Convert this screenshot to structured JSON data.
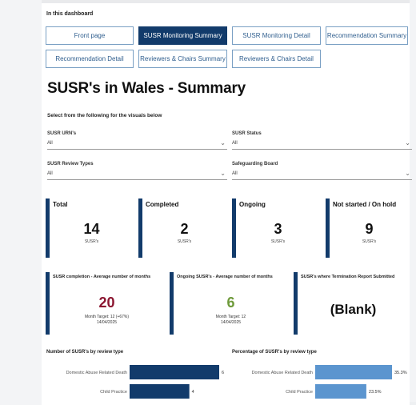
{
  "nav": {
    "title": "In this dashboard",
    "buttons": [
      {
        "label": "Front page",
        "active": false
      },
      {
        "label": "SUSR Monitoring Summary",
        "active": true
      },
      {
        "label": "SUSR Monitoring Detail",
        "active": false
      },
      {
        "label": "Recommendation Summary",
        "active": false
      },
      {
        "label": "Recommendation Detail",
        "active": false
      },
      {
        "label": "Reviewers & Chairs Summary",
        "active": false
      },
      {
        "label": "Reviewers & Chairs Detail",
        "active": false
      }
    ]
  },
  "page_title": "SUSR's in Wales - Summary",
  "filters": {
    "note": "Select from the following for the visuals below",
    "slicers": [
      {
        "label": "SUSR URN's",
        "value": "All"
      },
      {
        "label": "SUSR Status",
        "value": "All"
      },
      {
        "label": "SUSR Review Types",
        "value": "All"
      },
      {
        "label": "Safeguarding Board",
        "value": "All"
      }
    ]
  },
  "kpis": [
    {
      "title": "Total",
      "value": "14",
      "unit": "SUSR's"
    },
    {
      "title": "Completed",
      "value": "2",
      "unit": "SUSR's"
    },
    {
      "title": "Ongoing",
      "value": "3",
      "unit": "SUSR's"
    },
    {
      "title": "Not started / On hold",
      "value": "9",
      "unit": "SUSR's"
    }
  ],
  "kpis2": [
    {
      "title": "SUSR completion - Average number of months",
      "value": "20",
      "value_color": "#8b1530",
      "sub1": "Month Target: 12 (+67%)",
      "sub2": "14/04/2025"
    },
    {
      "title": "Ongoing SUSR's - Average number of months",
      "value": "6",
      "value_color": "#6e9a3a",
      "sub1": "Month Target: 12",
      "sub2": "14/04/2025"
    },
    {
      "title": "SUSR's where Termination Report Submitted",
      "value": "(Blank)"
    }
  ],
  "colors": {
    "navy": "#123b6b",
    "bar_dark": "#123b6b",
    "bar_light": "#5b95cf"
  },
  "chart_data": [
    {
      "type": "bar",
      "orientation": "horizontal",
      "title": "Number of SUSR's by review type",
      "categories": [
        "Domestic Abuse Related Death",
        "Child Practice"
      ],
      "values": [
        6,
        4
      ],
      "value_labels": [
        "6",
        "4"
      ],
      "xlim": [
        0,
        6
      ]
    },
    {
      "type": "bar",
      "orientation": "horizontal",
      "title": "Percentage of SUSR's by review type",
      "categories": [
        "Domestic Abuse Related Death",
        "Child Practice"
      ],
      "values": [
        35.3,
        23.5
      ],
      "value_labels": [
        "35.3%",
        "23.5%"
      ],
      "xlim": [
        0,
        35.3
      ]
    }
  ]
}
